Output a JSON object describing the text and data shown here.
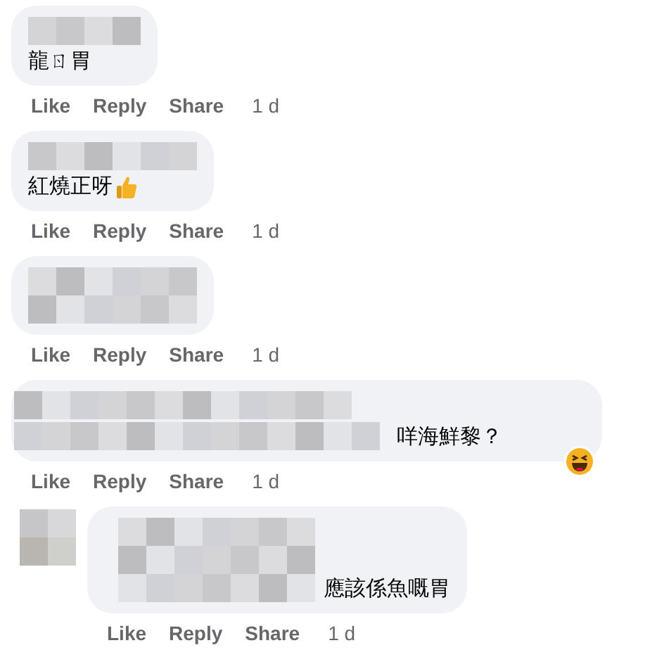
{
  "comments": [
    {
      "text": "龍ㄖ胃",
      "actions": [
        "Like",
        "Reply",
        "Share"
      ],
      "time": "1 d"
    },
    {
      "text": "紅燒正呀",
      "thumbs_up": true,
      "actions": [
        "Like",
        "Reply",
        "Share"
      ],
      "time": "1 d"
    },
    {
      "actions": [
        "Like",
        "Reply",
        "Share"
      ],
      "time": "1 d"
    },
    {
      "text": "咩海鮮黎？",
      "laugh_reaction": true,
      "actions": [
        "Like",
        "Reply",
        "Share"
      ],
      "time": "1 d",
      "children": [
        {
          "text": "應該係魚嘅胃",
          "actions": [
            "Like",
            "Reply",
            "Share"
          ],
          "time": "1 d"
        }
      ]
    }
  ]
}
